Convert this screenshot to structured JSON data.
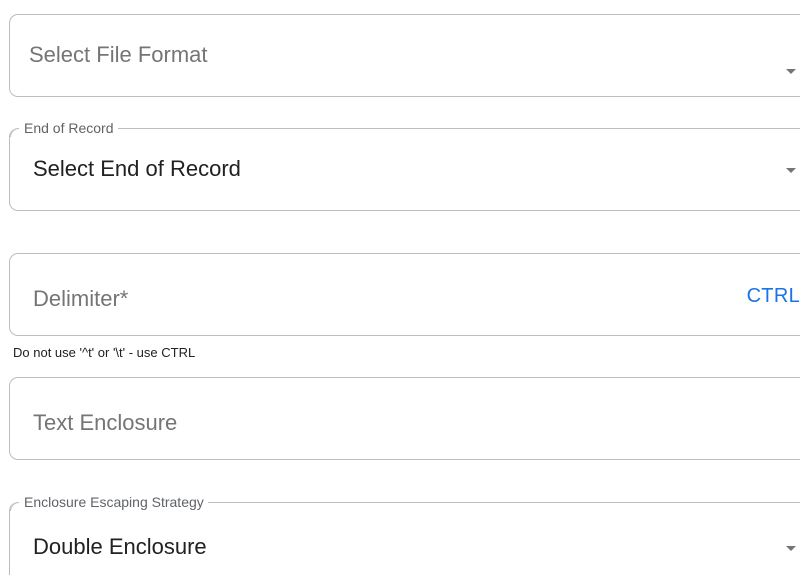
{
  "file_format": {
    "placeholder": "Select File Format"
  },
  "end_of_record": {
    "label": "End of Record",
    "value": "Select End of Record"
  },
  "delimiter": {
    "placeholder": "Delimiter*",
    "ctrl_label": "CTRL",
    "helper_text": "Do not use '^t' or '\\t' - use CTRL"
  },
  "text_enclosure": {
    "placeholder": "Text Enclosure"
  },
  "enclosure_escaping": {
    "label": "Enclosure Escaping Strategy",
    "value": "Double Enclosure"
  },
  "colors": {
    "accent": "#1a73e8",
    "border": "#bdbdbd",
    "placeholder": "#757575",
    "text": "#212121"
  },
  "icons": {
    "dropdown": "dropdown-arrow-icon"
  }
}
